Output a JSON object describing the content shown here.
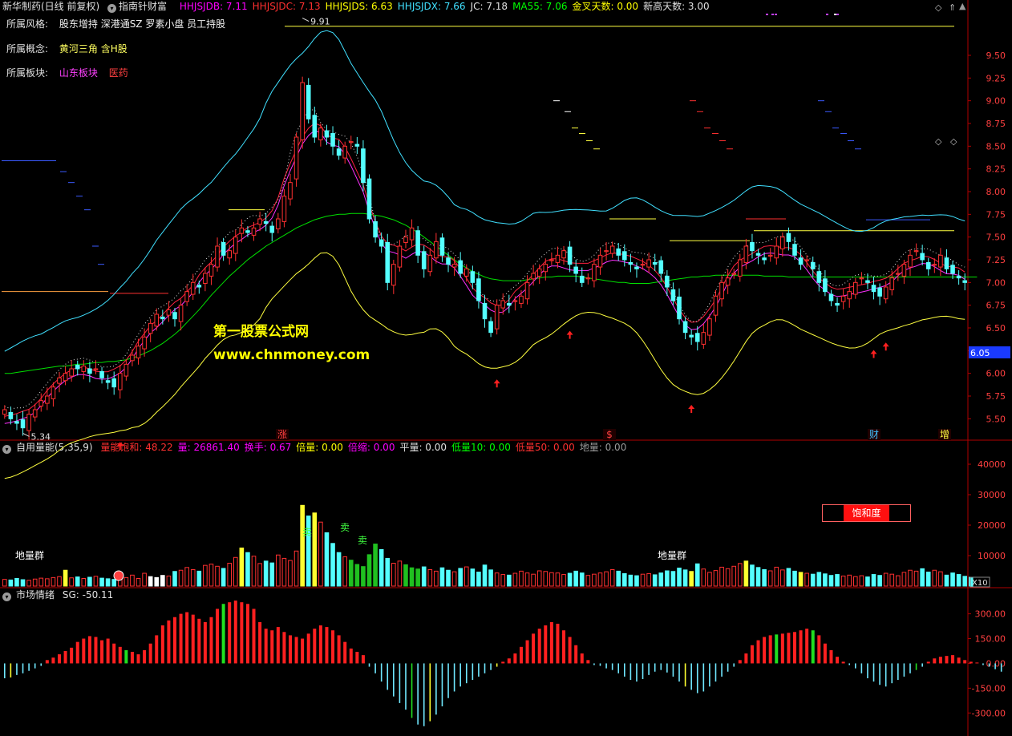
{
  "header": {
    "stock_name": "新华制药(日线 前复权)",
    "indicator_name": "指南针财富",
    "values": [
      {
        "label": "HHJSJDB: 7.11",
        "color": "#ff00ff"
      },
      {
        "label": "HHJSJDC: 7.13",
        "color": "#ff3030"
      },
      {
        "label": "HHJSJDS: 6.63",
        "color": "#ffff00"
      },
      {
        "label": "HHJSJDX: 7.66",
        "color": "#40e0ff"
      },
      {
        "label": "JC: 7.18",
        "color": "#e0e0e0"
      },
      {
        "label": "MA55: 7.06",
        "color": "#00ff00"
      },
      {
        "label": "金叉天数: 0.00",
        "color": "#ffff00"
      },
      {
        "label": "新高天数: 3.00",
        "color": "#e0e0e0"
      }
    ]
  },
  "info": {
    "style_label": "所属风格:",
    "style_value": "股东增持 深港通SZ 罗素小盘 员工持股",
    "concept_label": "所属概念:",
    "concept_value": "黄河三角 含H股",
    "sector_label": "所属板块:",
    "sector_values": [
      "山东板块",
      "医药"
    ]
  },
  "watermark": {
    "line1": "第一股票公式网",
    "line2": "www.chnmoney.com"
  },
  "price_panel": {
    "high_label": "9.91",
    "low_label": "5.34",
    "current_price": "6.05",
    "event_markers": [
      "涨",
      "$",
      "财",
      "增"
    ]
  },
  "volume_panel": {
    "title": "自用量能(5,35,9)",
    "values": [
      {
        "label": "量能饱和: 48.22",
        "color": "#ff3030"
      },
      {
        "label": "量: 26861.40",
        "color": "#ff00ff"
      },
      {
        "label": "换手: 0.67",
        "color": "#ff00ff"
      },
      {
        "label": "倍量: 0.00",
        "color": "#ffff00"
      },
      {
        "label": "倍缩: 0.00",
        "color": "#ff00ff"
      },
      {
        "label": "平量: 0.00",
        "color": "#e0e0e0"
      },
      {
        "label": "低量10: 0.00",
        "color": "#00ff00"
      },
      {
        "label": "低量50: 0.00",
        "color": "#ff3030"
      },
      {
        "label": "地量: 0.00",
        "color": "#9a9a9a"
      }
    ],
    "saturation_button": "饱和度",
    "annotations": [
      "地量群",
      "地量群",
      "卖",
      "卖",
      "卖"
    ],
    "multiplier": "X10"
  },
  "sentiment_panel": {
    "title": "市场情绪",
    "value_label": "SG: -50.11"
  },
  "colors": {
    "up": "#ff3030",
    "down": "#54ffff",
    "ma55": "#00e000",
    "upper_band": "#40e0ff",
    "lower_band": "#ffff40",
    "mid_red": "#ff2040",
    "mid_mag": "#ff30ff",
    "axis": "#b00000"
  },
  "chart_data": [
    {
      "type": "candlestick",
      "title": "指南针财富",
      "ylim": [
        5.3,
        9.95
      ],
      "yticks": [
        5.5,
        5.75,
        6.0,
        6.25,
        6.5,
        6.75,
        7.0,
        7.25,
        7.5,
        7.75,
        8.0,
        8.25,
        8.5,
        8.75,
        9.0,
        9.25,
        9.5
      ],
      "close": [
        5.6,
        5.5,
        5.45,
        5.4,
        5.55,
        5.6,
        5.7,
        5.75,
        5.85,
        5.95,
        6.0,
        6.05,
        6.05,
        6.08,
        6.0,
        6.05,
        5.95,
        5.9,
        5.85,
        6.0,
        6.1,
        6.2,
        6.3,
        6.4,
        6.55,
        6.65,
        6.6,
        6.7,
        6.6,
        6.75,
        6.9,
        7.0,
        6.95,
        7.1,
        7.2,
        7.4,
        7.3,
        7.35,
        7.5,
        7.6,
        7.55,
        7.6,
        7.7,
        7.65,
        7.55,
        7.7,
        7.95,
        8.1,
        8.6,
        9.2,
        8.8,
        8.6,
        8.7,
        8.6,
        8.5,
        8.4,
        8.5,
        8.55,
        8.5,
        8.1,
        7.7,
        7.5,
        7.4,
        7.0,
        7.2,
        7.4,
        7.5,
        7.6,
        7.3,
        7.15,
        7.3,
        7.45,
        7.3,
        7.2,
        7.2,
        7.1,
        7.15,
        7.0,
        6.8,
        6.6,
        6.45,
        6.75,
        6.8,
        6.75,
        6.8,
        6.85,
        7.0,
        7.1,
        7.15,
        7.2,
        7.25,
        7.3,
        7.35,
        7.2,
        7.1,
        7.0,
        7.05,
        7.2,
        7.3,
        7.35,
        7.4,
        7.3,
        7.25,
        7.2,
        7.15,
        7.2,
        7.25,
        7.2,
        7.1,
        6.95,
        6.8,
        6.6,
        6.45,
        6.4,
        6.35,
        6.45,
        6.6,
        6.85,
        7.0,
        7.05,
        7.1,
        7.25,
        7.4,
        7.35,
        7.3,
        7.25,
        7.3,
        7.4,
        7.5,
        7.45,
        7.3,
        7.2,
        7.25,
        7.15,
        7.0,
        6.9,
        6.8,
        6.75,
        6.85,
        6.9,
        7.0,
        7.05,
        7.0,
        6.9,
        6.85,
        6.95,
        7.05,
        7.1,
        7.2,
        7.3,
        7.35,
        7.25,
        7.15,
        7.2,
        7.3,
        7.15,
        7.1,
        7.05,
        7.0
      ],
      "ma55": [
        6.0,
        6.0,
        6.01,
        6.02,
        6.03,
        6.04,
        6.05,
        6.06,
        6.07,
        6.08,
        6.08,
        6.09,
        6.1,
        6.1,
        6.11,
        6.12,
        6.12,
        6.13,
        6.13,
        6.14,
        6.15,
        6.17,
        6.19,
        6.22,
        6.25,
        6.29,
        6.33,
        6.38,
        6.43,
        6.49,
        6.56,
        6.63,
        6.7,
        6.78,
        6.86,
        6.93,
        7.0,
        7.07,
        7.13,
        7.19,
        7.25,
        7.3,
        7.35,
        7.4,
        7.44,
        7.48,
        7.52,
        7.56,
        7.6,
        7.63,
        7.66,
        7.69,
        7.71,
        7.73,
        7.74,
        7.75,
        7.75,
        7.76,
        7.76,
        7.76,
        7.75,
        7.74,
        7.73,
        7.71,
        7.69,
        7.66,
        7.63,
        7.59,
        7.55,
        7.5,
        7.45,
        7.4,
        7.35,
        7.3,
        7.25,
        7.2,
        7.16,
        7.12,
        7.09,
        7.06,
        7.04,
        7.03,
        7.02,
        7.02,
        7.02,
        7.02,
        7.03,
        7.04,
        7.05,
        7.06,
        7.06,
        7.07,
        7.07,
        7.07,
        7.07,
        7.06,
        7.05,
        7.04,
        7.03,
        7.02,
        7.01,
        7.0,
        7.0,
        6.99,
        6.99,
        6.99,
        6.99,
        7.0,
        7.01,
        7.02,
        7.03,
        7.04,
        7.05,
        7.06,
        7.06,
        7.07,
        7.07,
        7.08,
        7.08,
        7.08,
        7.08,
        7.08,
        7.08,
        7.08,
        7.08,
        7.07,
        7.07,
        7.07,
        7.07,
        7.06,
        7.06,
        7.06,
        7.06,
        7.06,
        7.06,
        7.06,
        7.06,
        7.06,
        7.06,
        7.06,
        7.06,
        7.06,
        7.06,
        7.06,
        7.06,
        7.06,
        7.06,
        7.06,
        7.06,
        7.06,
        7.06,
        7.06,
        7.06,
        7.06,
        7.06,
        7.06,
        7.06,
        7.06,
        7.06,
        7.06,
        7.06
      ]
    },
    {
      "type": "bar",
      "title": "自用量能(5,35,9)",
      "ylim": [
        0,
        45000
      ],
      "yticks": [
        10000,
        20000,
        30000,
        40000
      ],
      "values": [
        2200,
        2000,
        2500,
        2100,
        1900,
        2300,
        2600,
        2400,
        2800,
        3100,
        5200,
        2700,
        3000,
        2500,
        2900,
        3200,
        2600,
        2400,
        2200,
        3000,
        2800,
        3600,
        2500,
        4200,
        3100,
        2800,
        3500,
        3300,
        4800,
        5200,
        6100,
        5400,
        4900,
        6800,
        7200,
        6500,
        5800,
        7500,
        9400,
        12500,
        11000,
        9800,
        7400,
        8200,
        7600,
        10200,
        9100,
        8400,
        11500,
        26500,
        23000,
        24000,
        21000,
        17500,
        14000,
        11000,
        9600,
        8500,
        7100,
        6400,
        10300,
        13800,
        12000,
        9100,
        7500,
        8200,
        7000,
        6000,
        5600,
        6300,
        5400,
        4900,
        6000,
        5200,
        4700,
        5800,
        6300,
        5600,
        4600,
        6900,
        5300,
        4300,
        3800,
        3600,
        4200,
        4900,
        4300,
        3900,
        5000,
        4800,
        4400,
        4300,
        3800,
        4200,
        4900,
        4300,
        3500,
        3900,
        4300,
        4700,
        5400,
        4900,
        4100,
        3600,
        3400,
        3900,
        4100,
        3700,
        4300,
        5000,
        4800,
        5900,
        5300,
        4800,
        7300,
        5600,
        4500,
        5100,
        6200,
        5700,
        6500,
        7400,
        8200,
        6900,
        6100,
        5400,
        5000,
        6200,
        5300,
        5800,
        4900,
        4500,
        4200,
        3900,
        4500,
        4000,
        3500,
        3800,
        3300,
        3600,
        3100,
        3400,
        3000,
        3800,
        3500,
        4200,
        3900,
        3400,
        4500,
        5200,
        4900,
        5700,
        4600,
        5200,
        4700,
        3600,
        4300,
        3800,
        3200,
        2900
      ]
    },
    {
      "type": "bar",
      "title": "市场情绪",
      "ylim": [
        -420,
        400
      ],
      "yticks": [
        300,
        150,
        0,
        -150,
        -300
      ],
      "values": [
        -90,
        -85,
        -70,
        -60,
        -45,
        -30,
        -15,
        20,
        35,
        55,
        75,
        95,
        130,
        150,
        165,
        160,
        140,
        150,
        120,
        100,
        80,
        70,
        55,
        80,
        120,
        170,
        230,
        260,
        280,
        300,
        310,
        295,
        270,
        250,
        280,
        330,
        360,
        370,
        380,
        370,
        360,
        330,
        250,
        210,
        200,
        220,
        190,
        170,
        160,
        150,
        180,
        210,
        230,
        220,
        200,
        170,
        130,
        90,
        70,
        50,
        -20,
        -60,
        -110,
        -160,
        -200,
        -240,
        -280,
        -330,
        -370,
        -380,
        -350,
        -310,
        -260,
        -210,
        -170,
        -140,
        -120,
        -100,
        -80,
        -60,
        -40,
        -20,
        10,
        30,
        60,
        100,
        140,
        180,
        210,
        230,
        250,
        240,
        200,
        160,
        110,
        60,
        20,
        -10,
        -15,
        -30,
        -40,
        -60,
        -80,
        -100,
        -110,
        -95,
        -70,
        -50,
        -40,
        -55,
        -80,
        -110,
        -140,
        -160,
        -180,
        -170,
        -140,
        -110,
        -80,
        -50,
        -20,
        20,
        60,
        110,
        140,
        160,
        170,
        175,
        180,
        185,
        190,
        200,
        210,
        200,
        170,
        120,
        80,
        40,
        10,
        -10,
        -30,
        -60,
        -90,
        -110,
        -130,
        -140,
        -120,
        -100,
        -80,
        -60,
        -40,
        -20,
        10,
        30,
        40,
        45,
        50,
        35,
        20,
        10,
        5,
        -10,
        -20,
        -35,
        -50
      ]
    }
  ]
}
